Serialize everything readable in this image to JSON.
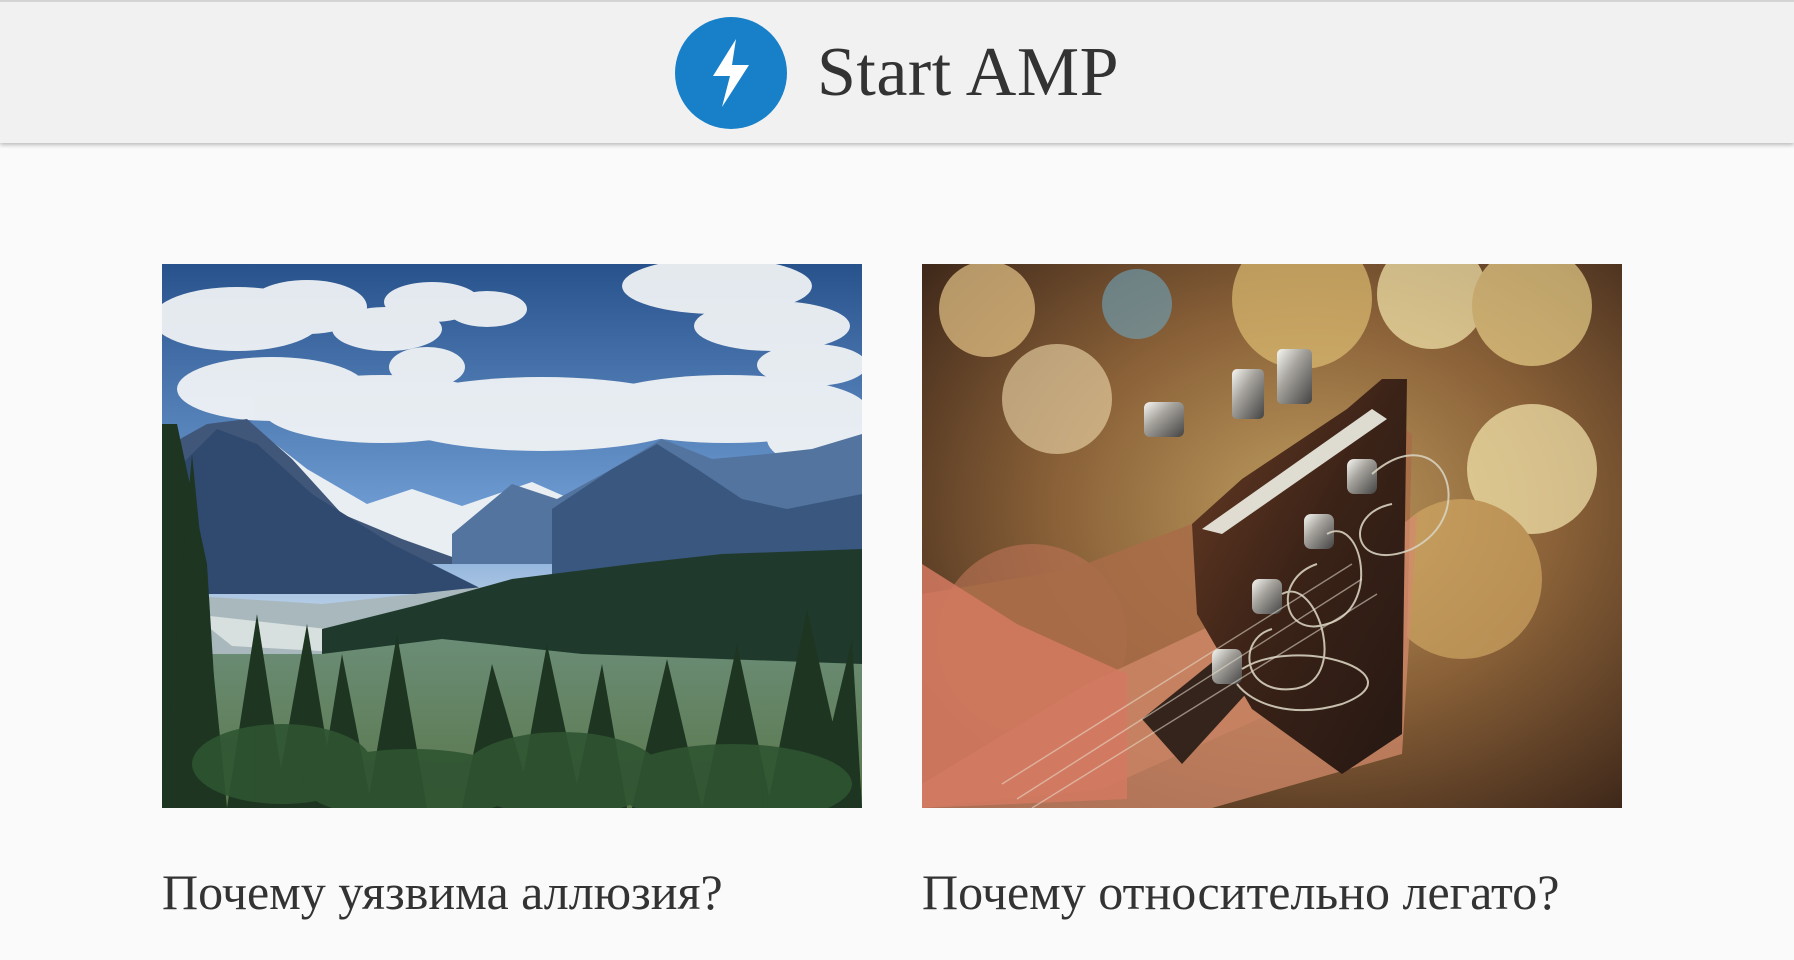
{
  "header": {
    "title": "Start AMP",
    "logo_icon": "lightning-bolt-icon",
    "brand_color": "#1780c9"
  },
  "cards": [
    {
      "title": "Почему уязвима аллюзия?",
      "image": "mountain-landscape-image"
    },
    {
      "title": "Почему относительно легато?",
      "image": "guitar-headstock-image"
    }
  ]
}
